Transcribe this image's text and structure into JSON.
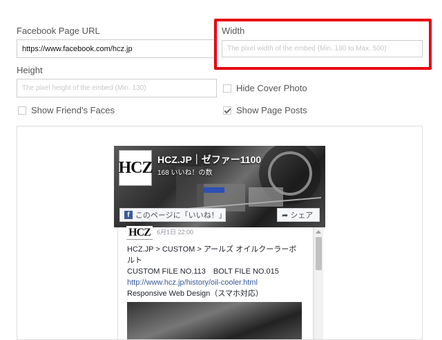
{
  "form": {
    "fb_url_label": "Facebook Page URL",
    "fb_url_value": "https://www.facebook.com/hcz.jp",
    "width_label": "Width",
    "width_placeholder": "The pixel width of the embed (Min. 180 to Max. 500)",
    "height_label": "Height",
    "height_placeholder": "The pixel height of the embed (Min. 130)",
    "hide_cover_label": "Hide Cover Photo",
    "hide_cover_checked": false,
    "show_faces_label": "Show Friend's Faces",
    "show_faces_checked": false,
    "show_posts_label": "Show Page Posts",
    "show_posts_checked": true
  },
  "highlight_color": "#e8000d",
  "preview": {
    "page_logo_text": "HCZ",
    "page_name": "HCZ.JP｜ゼファー1100",
    "likes": "168 いいね！の数",
    "like_button": "このページに「いいね！」",
    "share_button": "シェア",
    "post": {
      "date": "6月1日 22:00",
      "title": "HCZ.JP > CUSTOM > アールズ オイルクーラーボルト",
      "line2": "CUSTOM FILE NO.113　BOLT FILE NO.015",
      "link": "http://www.hcz.jp/history/oil-cooler.html",
      "line4": "Responsive Web Design（スマホ対応）"
    }
  }
}
